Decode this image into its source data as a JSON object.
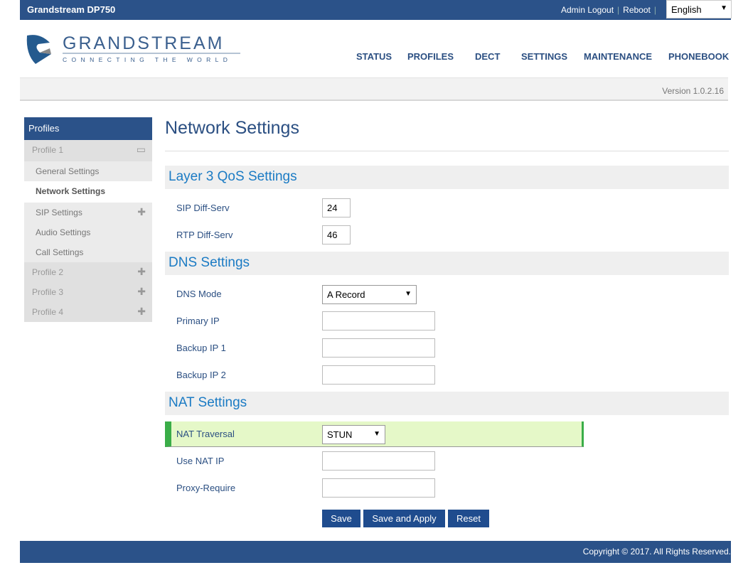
{
  "header": {
    "brand": "Grandstream DP750",
    "admin_logout": "Admin Logout",
    "reboot": "Reboot",
    "language": "English",
    "logo_text": "GRANDSTREAM",
    "logo_tagline": "CONNECTING THE WORLD"
  },
  "nav": [
    "STATUS",
    "PROFILES",
    "DECT",
    "SETTINGS",
    "MAINTENANCE",
    "PHONEBOOK"
  ],
  "version": "Version 1.0.2.16",
  "sidebar": {
    "title": "Profiles",
    "profile1": "Profile 1",
    "items": [
      "General Settings",
      "Network Settings",
      "SIP Settings",
      "Audio Settings",
      "Call Settings"
    ],
    "profiles": [
      "Profile 2",
      "Profile 3",
      "Profile 4"
    ]
  },
  "page": {
    "title": "Network Settings"
  },
  "qos": {
    "title": "Layer 3 QoS Settings",
    "sip_label": "SIP Diff-Serv",
    "sip_value": "24",
    "rtp_label": "RTP Diff-Serv",
    "rtp_value": "46"
  },
  "dns": {
    "title": "DNS Settings",
    "mode_label": "DNS Mode",
    "mode_value": "A Record",
    "primary_label": "Primary IP",
    "backup1_label": "Backup IP 1",
    "backup2_label": "Backup IP 2"
  },
  "nat": {
    "title": "NAT Settings",
    "traversal_label": "NAT Traversal",
    "traversal_value": "STUN",
    "use_nat_ip_label": "Use NAT IP",
    "proxy_require_label": "Proxy-Require"
  },
  "buttons": {
    "save": "Save",
    "save_apply": "Save and Apply",
    "reset": "Reset"
  },
  "footer": {
    "copyright": "Copyright © 2017. All Rights Reserved."
  }
}
